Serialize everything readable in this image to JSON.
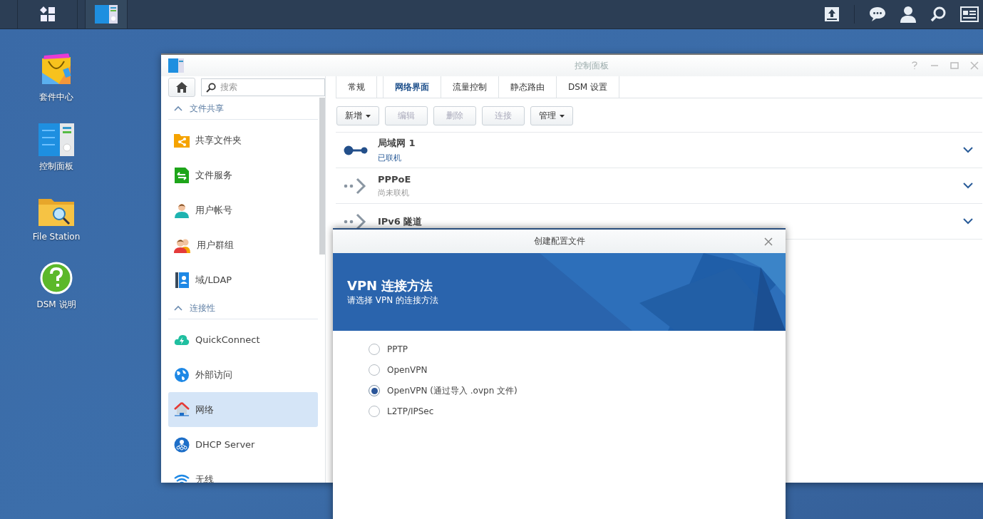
{
  "desktop_icons": [
    {
      "label": "套件中心",
      "kind": "package"
    },
    {
      "label": "控制面板",
      "kind": "control"
    },
    {
      "label": "File Station",
      "kind": "folder"
    },
    {
      "label": "DSM 说明",
      "kind": "help"
    }
  ],
  "window": {
    "title": "控制面板"
  },
  "sidebar": {
    "search": {
      "placeholder": "搜索"
    },
    "sections": [
      {
        "label": "文件共享",
        "expanded": true,
        "items": [
          {
            "label": "共享文件夹",
            "kind": "share",
            "selected": false
          },
          {
            "label": "文件服务",
            "kind": "files",
            "selected": false
          },
          {
            "label": "用户帐号",
            "kind": "user",
            "selected": false
          },
          {
            "label": "用户群组",
            "kind": "group",
            "selected": false
          },
          {
            "label": "域/LDAP",
            "kind": "ldap",
            "selected": false
          }
        ]
      },
      {
        "label": "连接性",
        "expanded": true,
        "items": [
          {
            "label": "QuickConnect",
            "kind": "cloud",
            "selected": false
          },
          {
            "label": "外部访问",
            "kind": "globe",
            "selected": false
          },
          {
            "label": "网络",
            "kind": "house",
            "selected": true
          },
          {
            "label": "DHCP Server",
            "kind": "dhcp",
            "selected": false
          },
          {
            "label": "无线",
            "kind": "wifi",
            "selected": false
          }
        ]
      }
    ]
  },
  "tabs": [
    {
      "label": "常规",
      "selected": false
    },
    {
      "label": "网络界面",
      "selected": true
    },
    {
      "label": "流量控制",
      "selected": false
    },
    {
      "label": "静态路由",
      "selected": false
    },
    {
      "label": "DSM 设置",
      "selected": false
    }
  ],
  "toolbar": [
    {
      "label": "新增",
      "disabled": false,
      "dropdown": true
    },
    {
      "label": "编辑",
      "disabled": true,
      "dropdown": false
    },
    {
      "label": "删除",
      "disabled": true,
      "dropdown": false
    },
    {
      "label": "连接",
      "disabled": true,
      "dropdown": false
    },
    {
      "label": "管理",
      "disabled": false,
      "dropdown": true
    }
  ],
  "interfaces": [
    {
      "name": "局域网 1",
      "status": "已联机",
      "connected": true
    },
    {
      "name": "PPPoE",
      "status": "尚未联机",
      "connected": false
    },
    {
      "name": "IPv6 隧道",
      "connected": false
    }
  ],
  "dialog": {
    "title": "创建配置文件",
    "heading": "VPN 连接方法",
    "subheading": "请选择 VPN 的连接方法",
    "options": [
      {
        "label": "PPTP",
        "selected": false
      },
      {
        "label": "OpenVPN",
        "selected": false
      },
      {
        "label": "OpenVPN (通过导入 .ovpn 文件)",
        "selected": true
      },
      {
        "label": "L2TP/IPSec",
        "selected": false
      }
    ]
  }
}
